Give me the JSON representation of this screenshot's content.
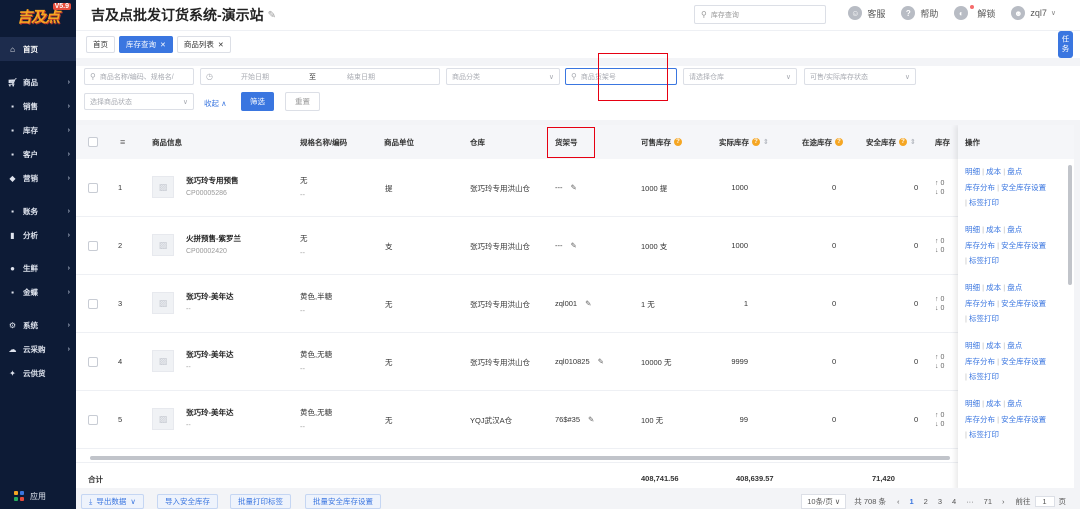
{
  "app": {
    "logo": "吉及点",
    "version": "V5.9",
    "title": "吉及点批发订货系统-演示站"
  },
  "sidebar": {
    "items": [
      {
        "label": "首页",
        "icon": "⌂",
        "has_arrow": false
      },
      {
        "label": "商品",
        "icon": "▪",
        "has_arrow": true
      },
      {
        "label": "销售",
        "icon": "▪",
        "has_arrow": true
      },
      {
        "label": "库存",
        "icon": "▪",
        "has_arrow": true
      },
      {
        "label": "客户",
        "icon": "▪",
        "has_arrow": true
      },
      {
        "label": "营销",
        "icon": "◆",
        "has_arrow": true
      },
      {
        "label": "账务",
        "icon": "▪",
        "has_arrow": true
      },
      {
        "label": "分析",
        "icon": "▪",
        "has_arrow": true
      },
      {
        "label": "生鲜",
        "icon": "●",
        "has_arrow": true
      },
      {
        "label": "金蝶",
        "icon": "▪",
        "has_arrow": true
      },
      {
        "label": "系统",
        "icon": "⚙",
        "has_arrow": true
      },
      {
        "label": "云采购",
        "icon": "☁",
        "has_arrow": true
      },
      {
        "label": "云供货",
        "icon": "✦",
        "has_arrow": false
      }
    ],
    "apps_label": "应用"
  },
  "header": {
    "search_placeholder": "库存查询",
    "tools": [
      {
        "label": "客服",
        "icon": "☺"
      },
      {
        "label": "帮助",
        "icon": "?"
      },
      {
        "label": "解锁",
        "icon": "◐"
      },
      {
        "label": "zql7",
        "icon": "☻"
      }
    ]
  },
  "tabs": [
    {
      "label": "首页",
      "active": false,
      "closable": false
    },
    {
      "label": "库存查询",
      "active": true,
      "closable": true
    },
    {
      "label": "商品列表",
      "active": false,
      "closable": true
    }
  ],
  "side_task": "任务",
  "filters": {
    "product_name_placeholder": "商品名称/编码、规格名/",
    "start_date_placeholder": "开始日期",
    "date_separator": "至",
    "end_date_placeholder": "结束日期",
    "category_placeholder": "商品分类",
    "shelf_placeholder": "商品货架号",
    "warehouse_placeholder": "请选择仓库",
    "stock_status_placeholder": "可售/实际库存状态",
    "product_status_placeholder": "选择商品状态",
    "collapse_label": "收起",
    "filter_button": "筛选",
    "reset_button": "重置"
  },
  "table": {
    "columns": {
      "product_info": "商品信息",
      "spec": "规格名称/编码",
      "unit": "商品单位",
      "warehouse": "仓库",
      "shelf": "货架号",
      "sellable": "可售库存",
      "actual": "实际库存",
      "in_transit": "在途库存",
      "safety": "安全库存",
      "stock_short": "库存",
      "actions": "操作"
    },
    "rows": [
      {
        "index": "1",
        "name": "张巧玲专用预售",
        "code": "CP00005286",
        "spec": "无",
        "spec_code": "--",
        "unit": "提",
        "warehouse": "张巧玲专用洪山仓",
        "shelf": "---",
        "sellable": "1000 提",
        "actual": "1000",
        "in_transit": "0",
        "safety": "0"
      },
      {
        "index": "2",
        "name": "火拼预售-紫罗兰",
        "code": "CP00002420",
        "spec": "无",
        "spec_code": "--",
        "unit": "支",
        "warehouse": "张巧玲专用洪山仓",
        "shelf": "---",
        "sellable": "1000 支",
        "actual": "1000",
        "in_transit": "0",
        "safety": "0"
      },
      {
        "index": "3",
        "name": "张巧玲-美年达",
        "code": "--",
        "spec": "黄色,半糖",
        "spec_code": "--",
        "unit": "无",
        "warehouse": "张巧玲专用洪山仓",
        "shelf": "zql001",
        "sellable": "1 无",
        "actual": "1",
        "in_transit": "0",
        "safety": "0"
      },
      {
        "index": "4",
        "name": "张巧玲-美年达",
        "code": "--",
        "spec": "黄色,无糖",
        "spec_code": "--",
        "unit": "无",
        "warehouse": "张巧玲专用洪山仓",
        "shelf": "zql010825",
        "sellable": "10000 无",
        "actual": "9999",
        "in_transit": "0",
        "safety": "0"
      },
      {
        "index": "5",
        "name": "张巧玲-美年达",
        "code": "--",
        "spec": "黄色,无糖",
        "spec_code": "--",
        "unit": "无",
        "warehouse": "YQJ武汉A仓",
        "shelf": "76$#35",
        "sellable": "100 无",
        "actual": "99",
        "in_transit": "0",
        "safety": "0"
      }
    ],
    "row_arrows": {
      "up": "↑ 0",
      "down": "↓ 0"
    },
    "row_actions": {
      "detail": "明细",
      "cost": "成本",
      "check": "盘点",
      "distribution": "库存分布",
      "safety_setting": "安全库存设置",
      "label_print": "标签打印"
    },
    "totals": {
      "label": "合计",
      "sellable": "408,741.56",
      "actual": "408,639.57",
      "safety": "71,420"
    }
  },
  "footer": {
    "buttons": [
      "导出数据",
      "导入安全库存",
      "批量打印标签",
      "批量安全库存设置"
    ],
    "page_size": "10条/页",
    "total": "共 708 条",
    "pages": [
      "1",
      "2",
      "3",
      "4",
      "···",
      "71"
    ],
    "current_page": "1",
    "goto_label": "前往",
    "goto_value": "1",
    "page_suffix": "页"
  }
}
